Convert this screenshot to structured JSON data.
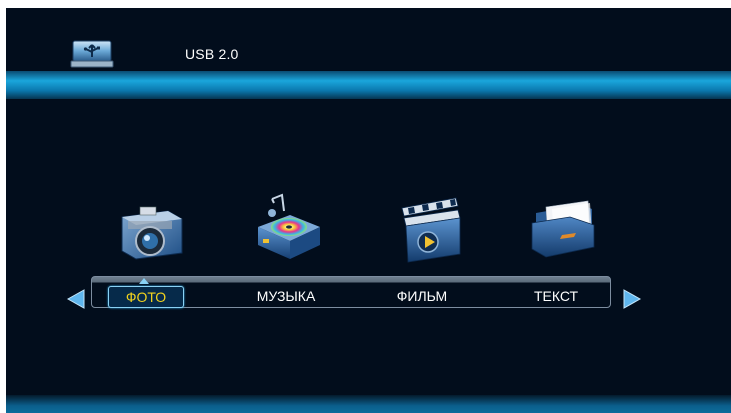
{
  "header": {
    "title": "USB 2.0",
    "icon": "usb-drive-icon"
  },
  "media_icons": [
    {
      "name": "camera-icon"
    },
    {
      "name": "music-box-icon"
    },
    {
      "name": "clapperboard-icon"
    },
    {
      "name": "document-folder-icon"
    }
  ],
  "menu": {
    "items": [
      {
        "label": "ФОТО",
        "selected": true
      },
      {
        "label": "МУЗЫКА",
        "selected": false
      },
      {
        "label": "ФИЛЬМ",
        "selected": false
      },
      {
        "label": "ТЕКСТ",
        "selected": false
      }
    ]
  },
  "colors": {
    "background": "#020d1c",
    "band": "#1aa6dc",
    "selected_text": "#f0d21e",
    "arrow": "#5fb6ee"
  }
}
